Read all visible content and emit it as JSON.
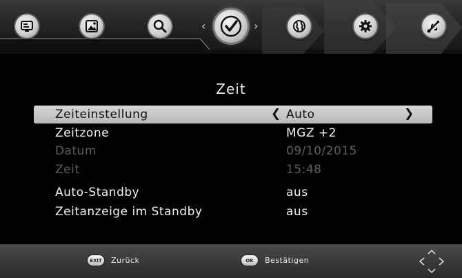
{
  "topbar": {
    "tabs": [
      {
        "icon": "tv-icon",
        "label": ""
      },
      {
        "icon": "picture-icon",
        "label": ""
      },
      {
        "icon": "search-icon",
        "label": ""
      },
      {
        "icon": "clock-icon",
        "label": "",
        "active": true
      },
      {
        "icon": "globe-icon",
        "label": ""
      },
      {
        "icon": "gear-icon",
        "label": ""
      },
      {
        "icon": "usb-icon",
        "label": ""
      }
    ],
    "prev_arrow": "‹",
    "next_arrow": "›"
  },
  "menu": {
    "title": "Zeit",
    "items": [
      {
        "label": "Zeiteinstellung",
        "value": "Auto",
        "selected": true,
        "enabled": true,
        "left_arrow": "❮",
        "right_arrow": "❯"
      },
      {
        "label": "Zeitzone",
        "value": "MGZ +2",
        "selected": false,
        "enabled": true
      },
      {
        "label": "Datum",
        "value": "09/10/2015",
        "selected": false,
        "enabled": false
      },
      {
        "label": "Zeit",
        "value": "15:48",
        "selected": false,
        "enabled": false
      },
      {
        "label": "Auto-Standby",
        "value": "aus",
        "selected": false,
        "enabled": true
      },
      {
        "label": "Zeitanzeige im Standby",
        "value": "aus",
        "selected": false,
        "enabled": true
      }
    ]
  },
  "bottombar": {
    "exit_key": "EXIT",
    "exit_label": "Zurück",
    "ok_key": "OK",
    "ok_label": "Bestätigen"
  },
  "colors": {
    "background": "#000000",
    "highlight": "#c8c8c8",
    "disabled_text": "#5e5e5e",
    "text": "#f2f2f2"
  }
}
